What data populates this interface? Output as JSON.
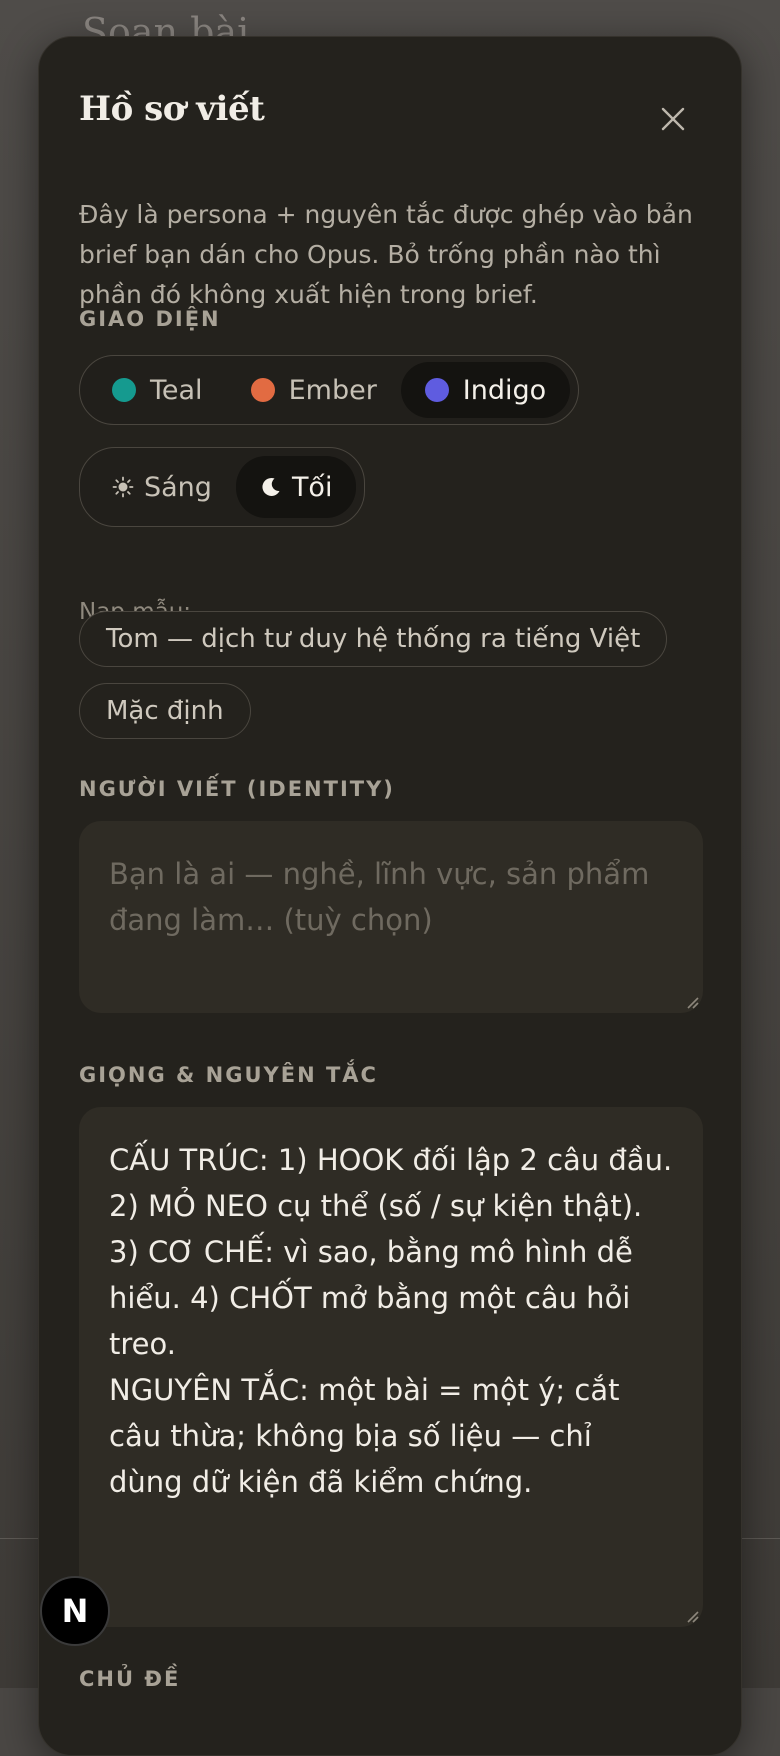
{
  "backdrop": {
    "title": "Soạn bài"
  },
  "modal": {
    "title": "Hồ sơ viết",
    "intro": "Đây là persona + nguyên tắc được ghép vào bản brief bạn dán cho Opus. Bỏ trống phần nào thì phần đó không xuất hiện trong brief.",
    "close_icon": "close-icon"
  },
  "appearance": {
    "label": "GIAO DIỆN",
    "themes": [
      {
        "label": "Teal",
        "color": "#159a8f",
        "selected": false
      },
      {
        "label": "Ember",
        "color": "#e26b42",
        "selected": false
      },
      {
        "label": "Indigo",
        "color": "#5f5ce0",
        "selected": true
      }
    ],
    "modes": [
      {
        "label": "Sáng",
        "icon": "sun-icon",
        "selected": false
      },
      {
        "label": "Tối",
        "icon": "moon-icon",
        "selected": true
      }
    ]
  },
  "presets": {
    "label": "Nạp mẫu:",
    "items": [
      "Tom — dịch tư duy hệ thống ra tiếng Việt",
      "Mặc định"
    ]
  },
  "identity": {
    "label": "NGƯỜI VIẾT (IDENTITY)",
    "placeholder": "Bạn là ai — nghề, lĩnh vực, sản phẩm đang làm… (tuỳ chọn)",
    "value": ""
  },
  "voice": {
    "label": "GIỌNG & NGUYÊN TẮC",
    "value": "CẤU TRÚC: 1) HOOK đối lập 2 câu đầu. 2) MỎ NEO cụ thể (số / sự kiện thật). 3) CƠ CHẾ: vì sao, bằng mô hình dễ hiểu. 4) CHỐT mở bằng một câu hỏi treo.\nNGUYÊN TẮC: một bài = một ý; cắt câu thừa; không bịa số liệu — chỉ dùng dữ kiện đã kiểm chứng."
  },
  "topics": {
    "label": "CHỦ ĐỀ"
  },
  "dev_badge": {
    "label": "N"
  }
}
